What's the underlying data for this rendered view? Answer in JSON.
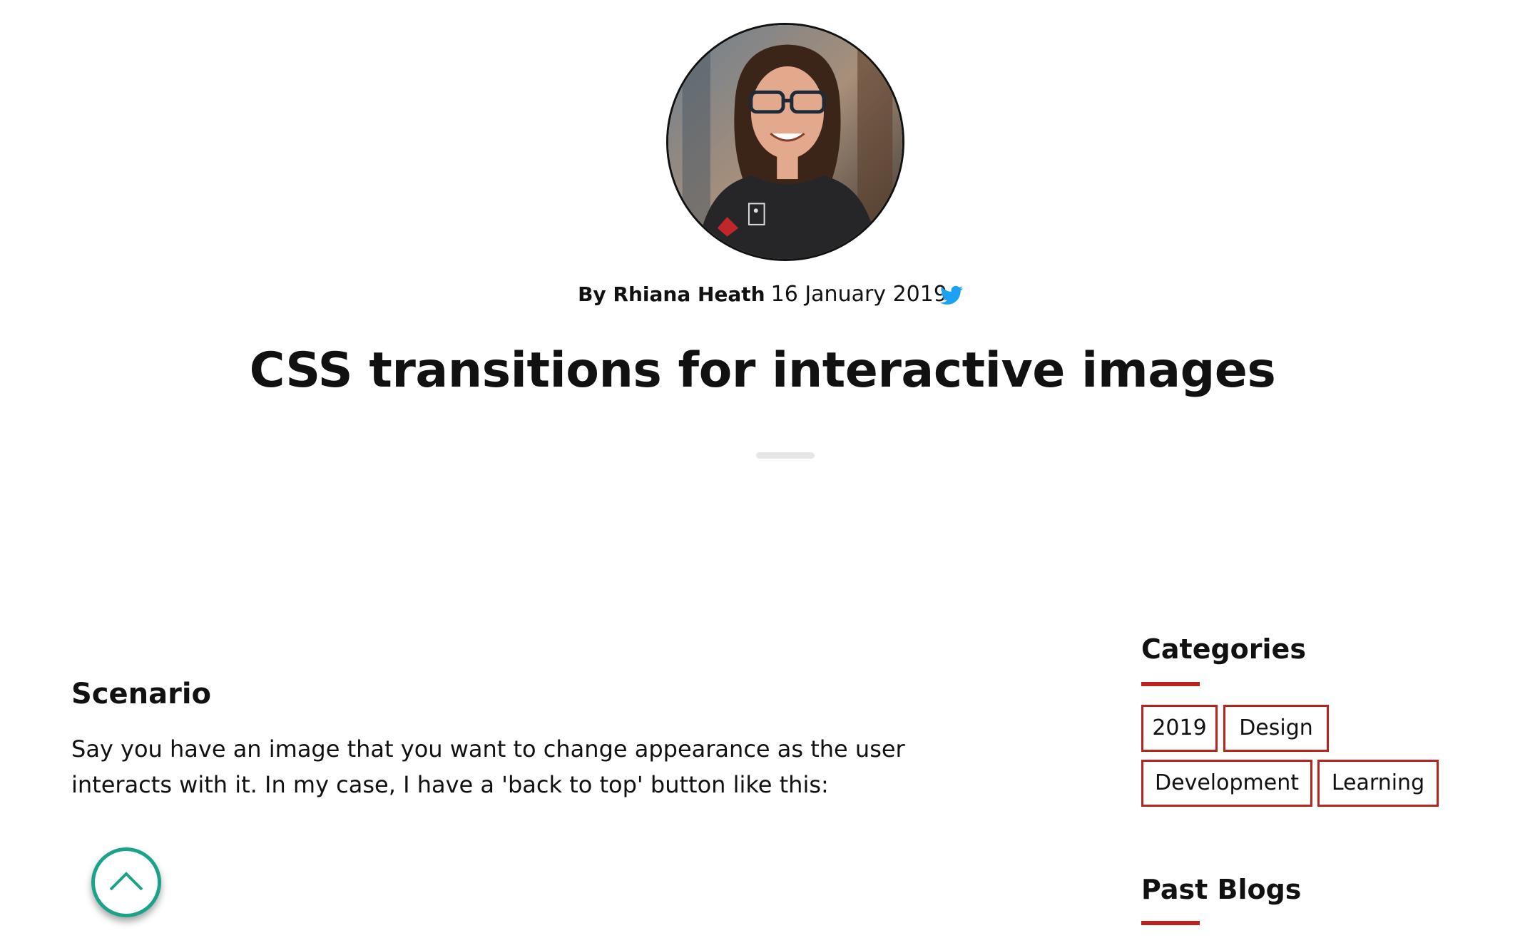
{
  "author": {
    "prefix": "By",
    "name": "Rhiana Heath",
    "date": "16 January 2019"
  },
  "post": {
    "title": "CSS transitions for interactive images",
    "section_heading": "Scenario",
    "paragraph": "Say you have an image that you want to change appearance as the user interacts with it. In my case, I have a 'back to top' button like this:"
  },
  "sidebar": {
    "categories_heading": "Categories",
    "tags": [
      "2019",
      "Design",
      "Development",
      "Learning"
    ],
    "past_blogs_heading": "Past Blogs"
  },
  "icons": {
    "social": "twitter-icon",
    "back_to_top": "chevron-up-icon"
  },
  "colors": {
    "accent": "#b8231e",
    "twitter": "#1da1f2",
    "back_to_top": "#1aa38a"
  }
}
